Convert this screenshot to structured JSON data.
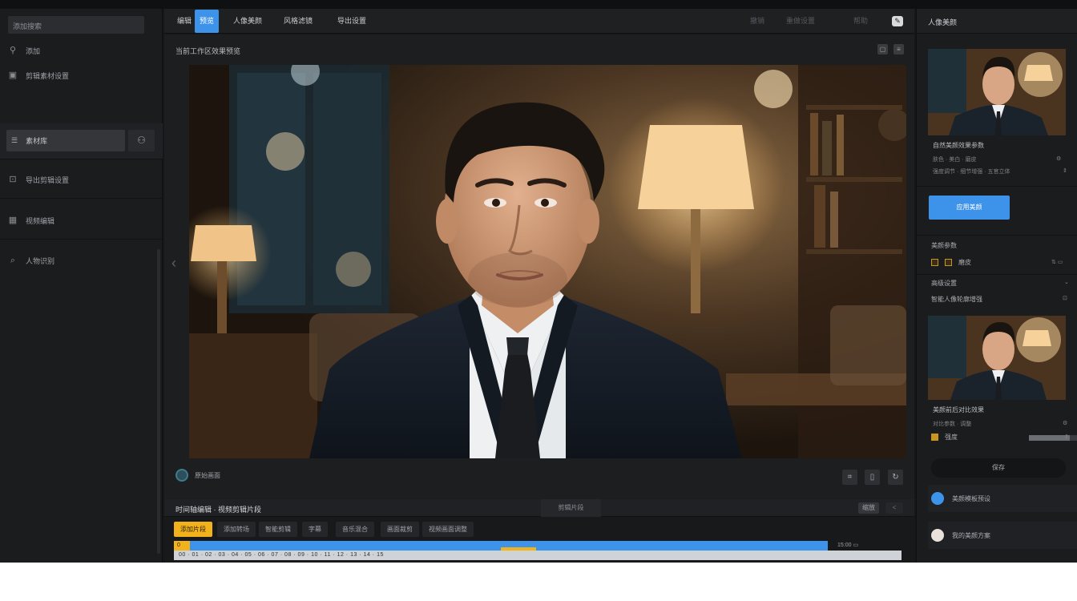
{
  "left": {
    "search": "添加搜索",
    "items": [
      {
        "icon": "link-icon",
        "label": "添加"
      },
      {
        "icon": "calendar-icon",
        "label": "剪辑素材设置"
      },
      {
        "icon": "list-icon",
        "label": "素材库"
      },
      {
        "icon": "download-icon",
        "label": "导出剪辑设置"
      },
      {
        "icon": "grid-icon",
        "label": "视频编辑"
      },
      {
        "icon": "search-user-icon",
        "label": "人物识别"
      }
    ]
  },
  "tabs": {
    "items": [
      "编辑",
      "预览",
      "人像美颜",
      "风格滤镜",
      "导出设置"
    ],
    "active_index": 1,
    "right_items": [
      "撤销",
      "重做设置",
      "帮助"
    ]
  },
  "center": {
    "title": "当前工作区效果预览",
    "footer_label": "原始画面",
    "prev_arrow": "‹"
  },
  "timeline": {
    "title": "时间轴编辑 · 视频剪辑片段",
    "mid_label": "剪辑片段",
    "btn1": "缩放",
    "btn2": "<",
    "chips": [
      "添加片段",
      "添加转场",
      "智能剪辑",
      "字幕",
      "音乐混合",
      "画面裁剪",
      "视频画面调整"
    ],
    "active_chip": 0,
    "track_start": "0",
    "ruler": "00 · 01 · 02 · 03 · 04 · 05 · 06 · 07 · 08 · 09 · 10 · 11 · 12 · 13 · 14 · 15",
    "right_marks": "15:00    ▭"
  },
  "right": {
    "header": "人像美颜",
    "card1": {
      "title": "自然美颜效果参数",
      "line1": "肤色 · 美白 · 磨皮",
      "line2": "强度调节 · 细节增强 · 五官立体"
    },
    "apply_button": "应用美颜",
    "section1": {
      "title": "美颜参数",
      "row": "磨皮"
    },
    "section2": {
      "title": "高级设置",
      "row": "智能人像轮廓增强"
    },
    "card2": {
      "title": "美颜前后对比效果",
      "line1": "对比参数 · 调整",
      "line2": "强度"
    },
    "pill": "保存",
    "users": [
      {
        "label": "美颜模板预设",
        "color": "#3d93ea"
      },
      {
        "label": "我的美颜方案",
        "color": "#e8e2da"
      }
    ]
  }
}
